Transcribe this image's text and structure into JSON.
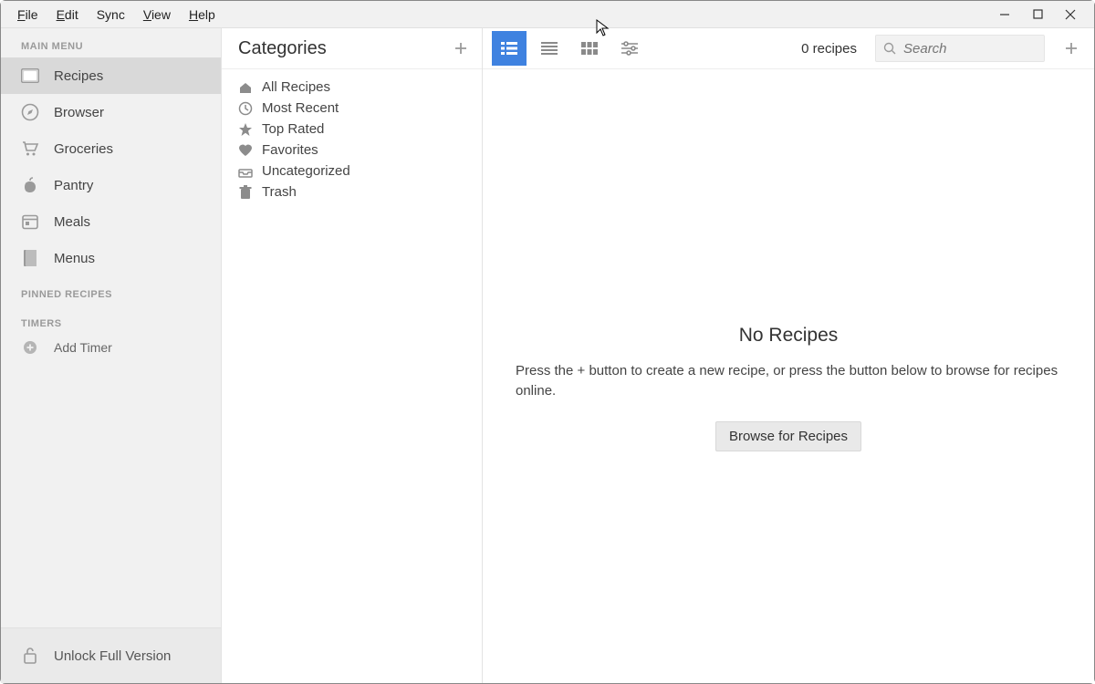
{
  "menubar": {
    "items": [
      "File",
      "Edit",
      "Sync",
      "View",
      "Help"
    ]
  },
  "sidebar": {
    "main_heading": "MAIN MENU",
    "items": [
      {
        "label": "Recipes",
        "icon": "recipe-card-icon",
        "active": true
      },
      {
        "label": "Browser",
        "icon": "compass-icon"
      },
      {
        "label": "Groceries",
        "icon": "cart-icon"
      },
      {
        "label": "Pantry",
        "icon": "apple-icon"
      },
      {
        "label": "Meals",
        "icon": "calendar-icon"
      },
      {
        "label": "Menus",
        "icon": "book-icon"
      }
    ],
    "pinned_heading": "PINNED RECIPES",
    "timers_heading": "TIMERS",
    "add_timer_label": "Add Timer",
    "unlock_label": "Unlock Full Version"
  },
  "categories": {
    "title": "Categories",
    "items": [
      {
        "label": "All Recipes",
        "icon": "home-icon"
      },
      {
        "label": "Most Recent",
        "icon": "clock-icon"
      },
      {
        "label": "Top Rated",
        "icon": "star-icon"
      },
      {
        "label": "Favorites",
        "icon": "heart-icon"
      },
      {
        "label": "Uncategorized",
        "icon": "tray-icon"
      },
      {
        "label": "Trash",
        "icon": "trash-icon"
      }
    ]
  },
  "toolbar": {
    "count_label": "0 recipes",
    "search_placeholder": "Search"
  },
  "empty": {
    "title": "No Recipes",
    "message": "Press the + button to create a new recipe, or press the button below to browse for recipes online.",
    "browse_label": "Browse for Recipes"
  }
}
